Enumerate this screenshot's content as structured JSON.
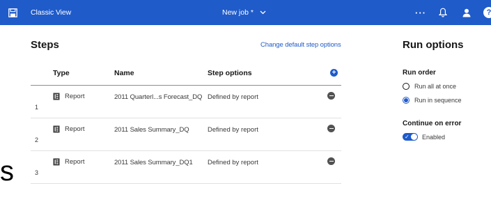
{
  "header": {
    "app_title": "Classic View",
    "job_title": "New job *",
    "more_label": "···",
    "help_label": "?",
    "icons": [
      "save-icon",
      "chevron-down-icon",
      "notification-bell-icon",
      "user-icon",
      "help-icon"
    ]
  },
  "steps": {
    "title": "Steps",
    "change_link": "Change default step options",
    "columns": {
      "type": "Type",
      "name": "Name",
      "options": "Step options"
    },
    "add_label": "+",
    "rows": [
      {
        "num": "1",
        "type": "Report",
        "name": "2011 Quarterl...s Forecast_DQ",
        "options": "Defined by report"
      },
      {
        "num": "2",
        "type": "Report",
        "name": "2011 Sales Summary_DQ",
        "options": "Defined by report"
      },
      {
        "num": "3",
        "type": "Report",
        "name": "2011 Sales Summary_DQ1",
        "options": "Defined by report"
      }
    ]
  },
  "run_options": {
    "title": "Run options",
    "run_order_label": "Run order",
    "run_order_options": [
      "Run all at once",
      "Run in sequence"
    ],
    "run_order_selected": "Run in sequence",
    "continue_label": "Continue on error",
    "continue_state": "Enabled",
    "continue_enabled": true
  },
  "stray_text": "s",
  "colors": {
    "accent": "#1f5bc9",
    "text": "#161616",
    "remove": "#525252"
  }
}
